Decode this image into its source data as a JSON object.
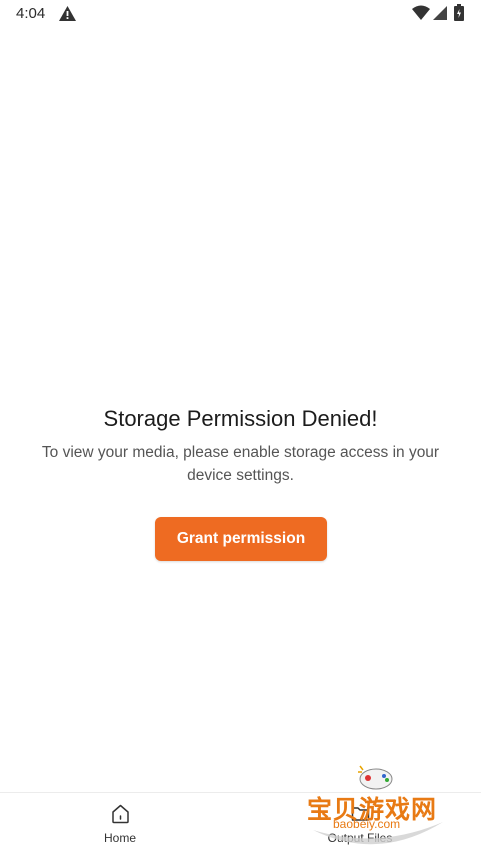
{
  "status_bar": {
    "time": "4:04",
    "icons": [
      "alert-icon",
      "wifi-icon",
      "signal-icon",
      "battery-icon"
    ]
  },
  "permission": {
    "title": "Storage Permission Denied!",
    "message": "To view your media, please enable storage access in your device settings.",
    "button_label": "Grant permission"
  },
  "bottom_nav": {
    "items": [
      {
        "label": "Home",
        "icon": "home-icon"
      },
      {
        "label": "Output Files",
        "icon": "folder-icon"
      }
    ]
  },
  "watermark": {
    "text": "宝贝游戏网",
    "url": "baobeiy.com"
  },
  "colors": {
    "accent": "#ee6b22",
    "watermark": "#e87a14"
  }
}
